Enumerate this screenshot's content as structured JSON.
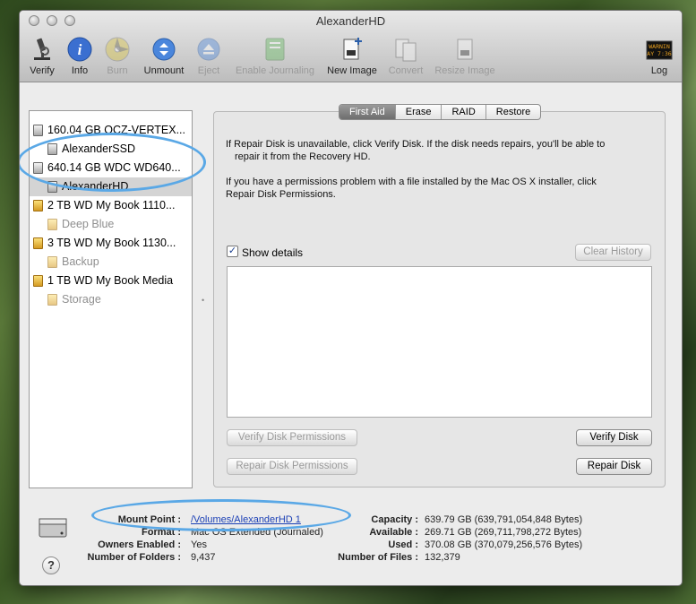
{
  "window": {
    "title": "AlexanderHD"
  },
  "toolbar": [
    {
      "label": "Verify",
      "icon": "microscope-icon",
      "enabled": true
    },
    {
      "label": "Info",
      "icon": "info-icon",
      "enabled": true
    },
    {
      "label": "Burn",
      "icon": "burn-disc-icon",
      "enabled": false
    },
    {
      "label": "Unmount",
      "icon": "unmount-icon",
      "enabled": true
    },
    {
      "label": "Eject",
      "icon": "eject-icon",
      "enabled": false
    },
    {
      "label": "Enable Journaling",
      "icon": "journaling-icon",
      "enabled": false
    },
    {
      "label": "New Image",
      "icon": "new-image-icon",
      "enabled": true
    },
    {
      "label": "Convert",
      "icon": "convert-icon",
      "enabled": false
    },
    {
      "label": "Resize Image",
      "icon": "resize-image-icon",
      "enabled": false
    },
    {
      "label": "Log",
      "icon": "log-icon",
      "enabled": true
    }
  ],
  "log_icon_text": {
    "line1": "WARNIN",
    "line2": "AY 7:36"
  },
  "sidebar": {
    "items": [
      {
        "label": "160.04 GB OCZ-VERTEX...",
        "level": 0,
        "kind": "gray",
        "selected": false,
        "dim": false
      },
      {
        "label": "AlexanderSSD",
        "level": 1,
        "kind": "gray",
        "selected": false,
        "dim": false
      },
      {
        "label": "640.14 GB WDC WD640...",
        "level": 0,
        "kind": "gray",
        "selected": false,
        "dim": false
      },
      {
        "label": "AlexanderHD",
        "level": 1,
        "kind": "gray",
        "selected": true,
        "dim": false
      },
      {
        "label": "2 TB WD My Book 1110...",
        "level": 0,
        "kind": "yellow",
        "selected": false,
        "dim": false
      },
      {
        "label": "Deep Blue",
        "level": 1,
        "kind": "yellow",
        "selected": false,
        "dim": true
      },
      {
        "label": "3 TB WD My Book 1130...",
        "level": 0,
        "kind": "yellow",
        "selected": false,
        "dim": false
      },
      {
        "label": "Backup",
        "level": 1,
        "kind": "yellow",
        "selected": false,
        "dim": true
      },
      {
        "label": "1 TB WD My Book Media",
        "level": 0,
        "kind": "yellow",
        "selected": false,
        "dim": false
      },
      {
        "label": "Storage",
        "level": 1,
        "kind": "yellow",
        "selected": false,
        "dim": true
      }
    ]
  },
  "tabs": [
    {
      "label": "First Aid",
      "active": true
    },
    {
      "label": "Erase",
      "active": false
    },
    {
      "label": "RAID",
      "active": false
    },
    {
      "label": "Restore",
      "active": false
    }
  ],
  "first_aid": {
    "para1_line1": "If Repair Disk is unavailable, click Verify Disk. If the disk needs repairs, you'll be able to",
    "para1_line2": "repair it from the Recovery HD.",
    "para2_line1": "If you have a permissions problem with a file installed by the Mac OS X installer, click",
    "para2_line2": "Repair Disk Permissions.",
    "show_details_label": "Show details",
    "show_details_checked": true,
    "clear_history": "Clear History",
    "verify_permissions": "Verify Disk Permissions",
    "repair_permissions": "Repair Disk Permissions",
    "verify_disk": "Verify Disk",
    "repair_disk": "Repair Disk"
  },
  "info": {
    "mount_point_label": "Mount Point :",
    "mount_point_value": "/Volumes/AlexanderHD 1",
    "format_label": "Format :",
    "format_value": "Mac OS Extended (Journaled)",
    "owners_label": "Owners Enabled :",
    "owners_value": "Yes",
    "folders_label": "Number of Folders :",
    "folders_value": "9,437",
    "capacity_label": "Capacity :",
    "capacity_value": "639.79 GB (639,791,054,848 Bytes)",
    "available_label": "Available :",
    "available_value": "269.71 GB (269,711,798,272 Bytes)",
    "used_label": "Used :",
    "used_value": "370.08 GB (370,079,256,576 Bytes)",
    "files_label": "Number of Files :",
    "files_value": "132,379"
  },
  "help_label": "?",
  "colors": {
    "highlight_oval": "#5aa8e6",
    "selection": "#d4d4d4",
    "link": "#1a3fb5"
  }
}
